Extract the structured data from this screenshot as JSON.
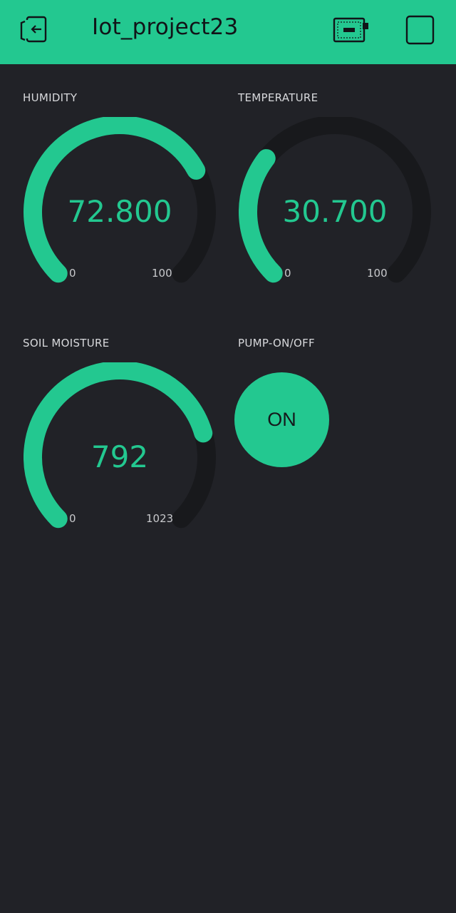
{
  "header": {
    "title": "Iot_project23",
    "back_icon": "exit-icon",
    "device_icon": "device-icon",
    "play_icon": "square-icon"
  },
  "widgets": {
    "humidity": {
      "label": "HUMIDITY",
      "value": "72.800",
      "min": "0",
      "max": "100",
      "level": 0.728
    },
    "temperature": {
      "label": "TEMPERATURE",
      "value": "30.700",
      "min": "0",
      "max": "100",
      "level": 0.307
    },
    "soil": {
      "label": "SOIL MOISTURE",
      "value": "792",
      "min": "0",
      "max": "1023",
      "level": 0.774
    },
    "pump": {
      "label": "PUMP-ON/OFF",
      "state": "ON"
    }
  },
  "colors": {
    "accent": "#23c890",
    "background": "#212227",
    "track": "#18191c",
    "header_text": "#111418"
  }
}
